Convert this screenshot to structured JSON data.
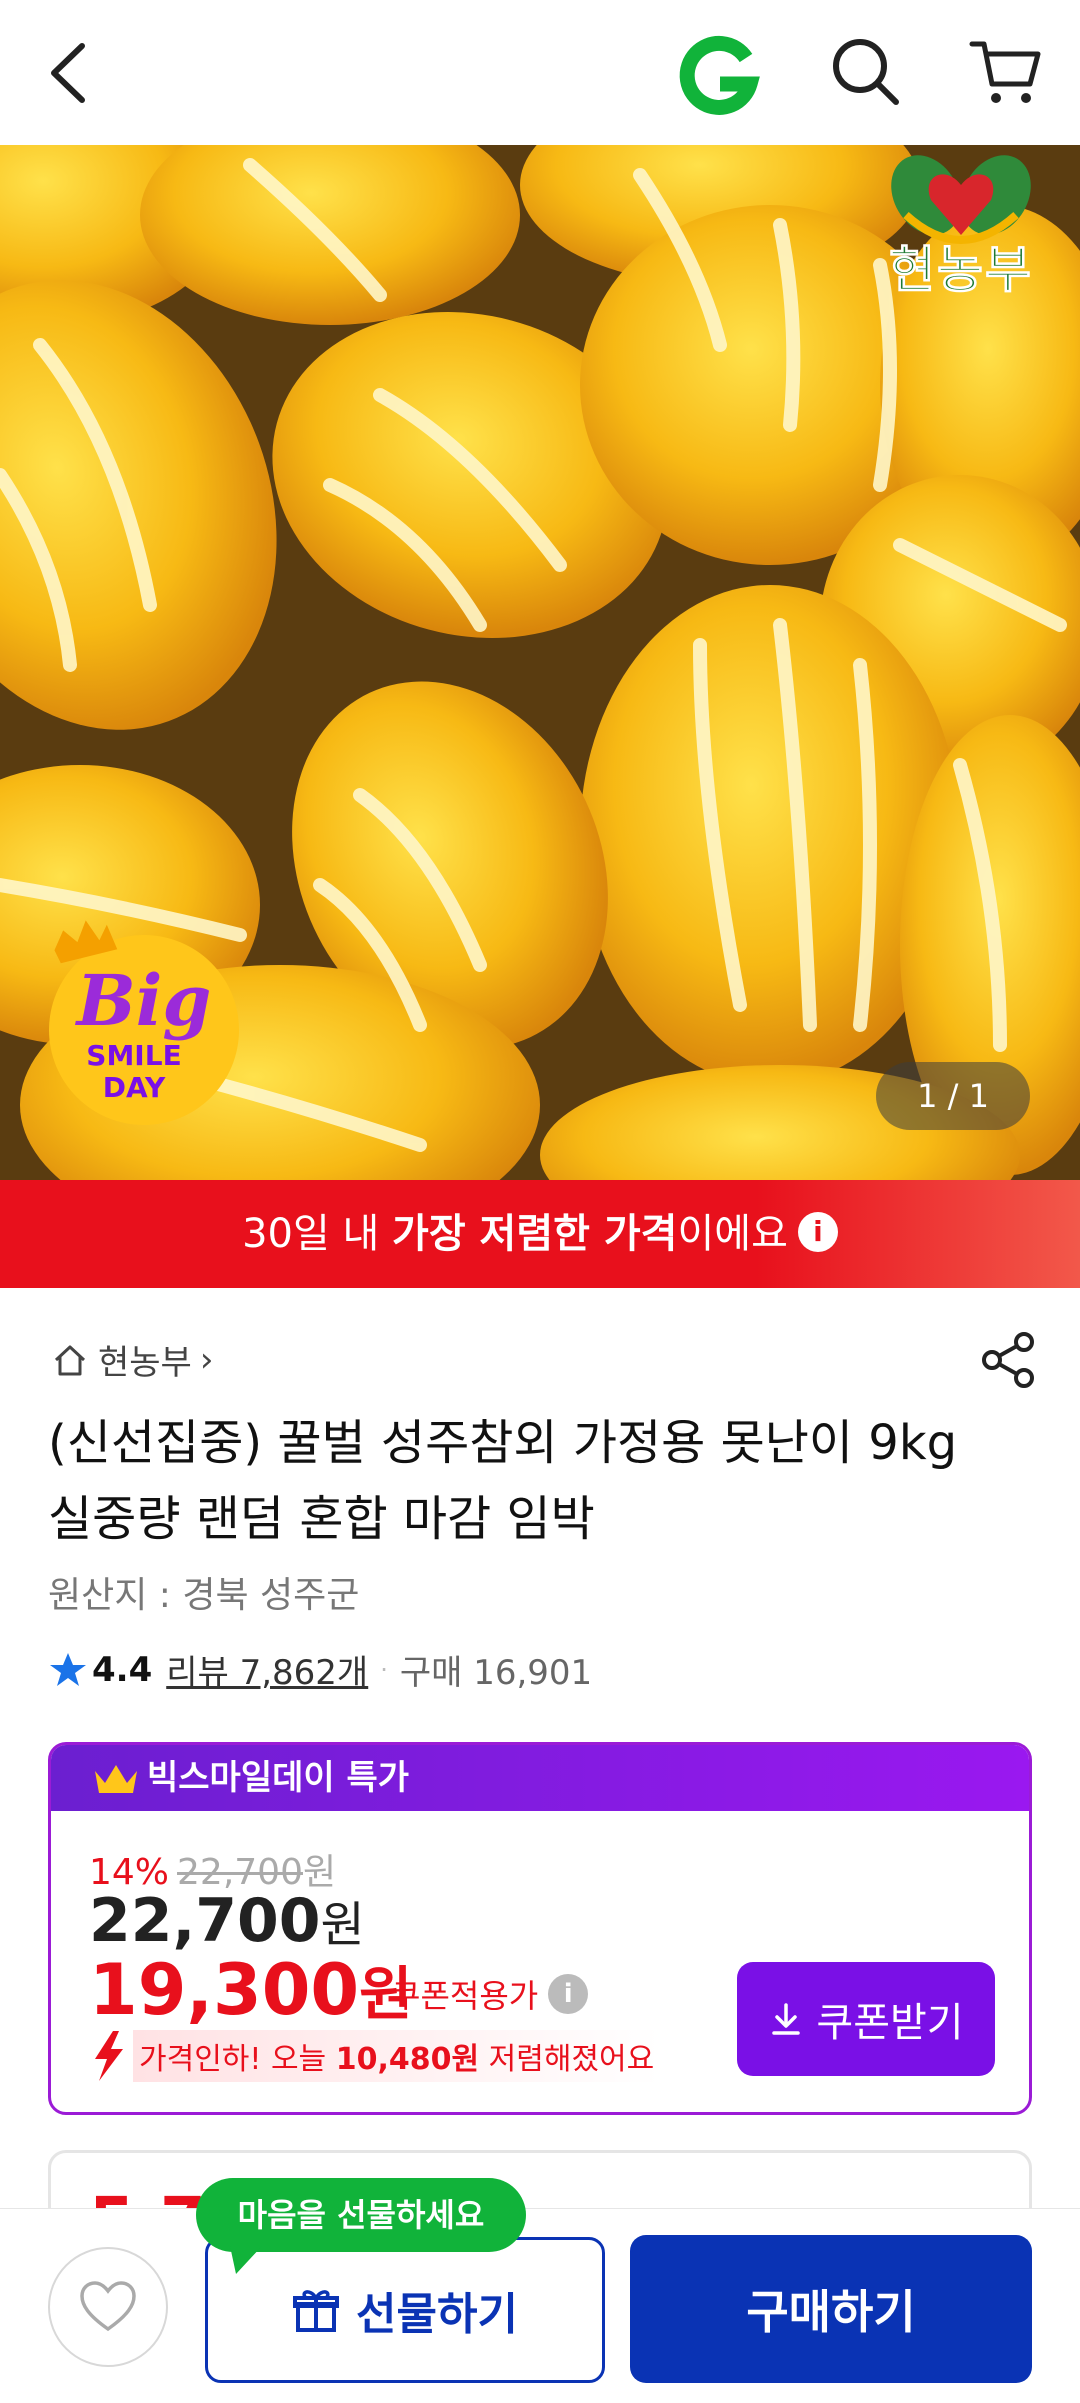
{
  "header": {
    "back_icon": "chevron-left-icon",
    "brand_icon": "gmarket-g-icon",
    "search_icon": "search-icon",
    "cart_icon": "cart-icon"
  },
  "hero": {
    "seller_logo_text": "현농부",
    "promo_badge": {
      "line1": "Big",
      "line2": "SMILE",
      "line3": "DAY"
    },
    "pager": "1 / 1"
  },
  "banner": {
    "prefix": "30일 내 ",
    "highlight": "가장 저렴한 가격",
    "suffix": "이에요",
    "info_glyph": "i",
    "color": "#e8101c"
  },
  "product": {
    "seller": "현농부",
    "seller_arrow": "›",
    "title": "(신선집중) 꿀벌 성주참외 가정용 못난이 9kg 실중량 랜덤 혼합 마감 임박",
    "origin": "원산지 : 경북 성주군",
    "rating": "4.4",
    "reviews": "리뷰 7,862개",
    "dot": "·",
    "purchases": "구매 16,901"
  },
  "price_card": {
    "header": "빅스마일데이 특가",
    "discount_pct": "14%",
    "original_price": "22,700",
    "won": "원",
    "price": "22,700",
    "coupon_price": "19,300",
    "coupon_label": "쿠폰적용가",
    "info_glyph": "i",
    "price_cut_prefix": "가격인하! 오늘 ",
    "price_cut_amount": "10,480원",
    "price_cut_suffix": " 저렴해졌어요",
    "coupon_button": "쿠폰받기",
    "accent": "#7a10e6"
  },
  "next_card": {
    "partial_price": "5,7"
  },
  "bottom_bar": {
    "wish_icon": "heart-icon",
    "tooltip": "마음을 선물하세요",
    "gift_button": "선물하기",
    "buy_button": "구매하기",
    "primary_color": "#0a33b4"
  }
}
